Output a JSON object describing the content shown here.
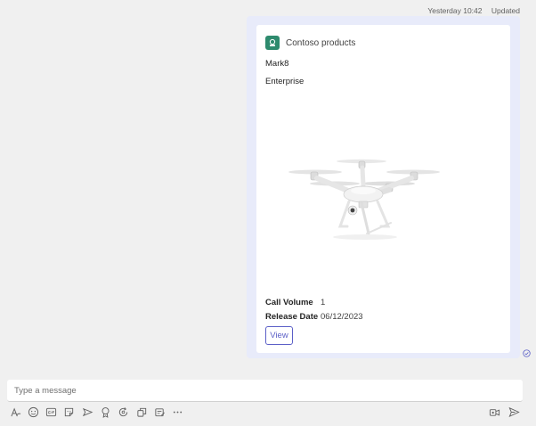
{
  "message": {
    "timestamp": "Yesterday 10:42",
    "status": "Updated"
  },
  "card": {
    "app_name": "Contoso products",
    "product_name": "Mark8",
    "category": "Enterprise",
    "image_icon": "drone-image",
    "facts": [
      {
        "title": "Call Volume",
        "value": "1"
      },
      {
        "title": "Release Date",
        "value": "06/12/2023"
      }
    ],
    "action_label": "View"
  },
  "compose": {
    "placeholder": "Type a message"
  },
  "toolbar": {
    "icons": [
      "format-icon",
      "emoji-icon",
      "gif-icon",
      "sticker-icon",
      "send-later-icon",
      "praise-icon",
      "loop-icon",
      "apps-icon",
      "notes-icon",
      "more-icon"
    ],
    "right_icons": [
      "dictate-icon",
      "send-icon"
    ]
  },
  "colors": {
    "accent": "#5b5fc7",
    "bubble": "#e8ebfa",
    "app_icon": "#2e8b6e",
    "background": "#f0f0f0"
  }
}
